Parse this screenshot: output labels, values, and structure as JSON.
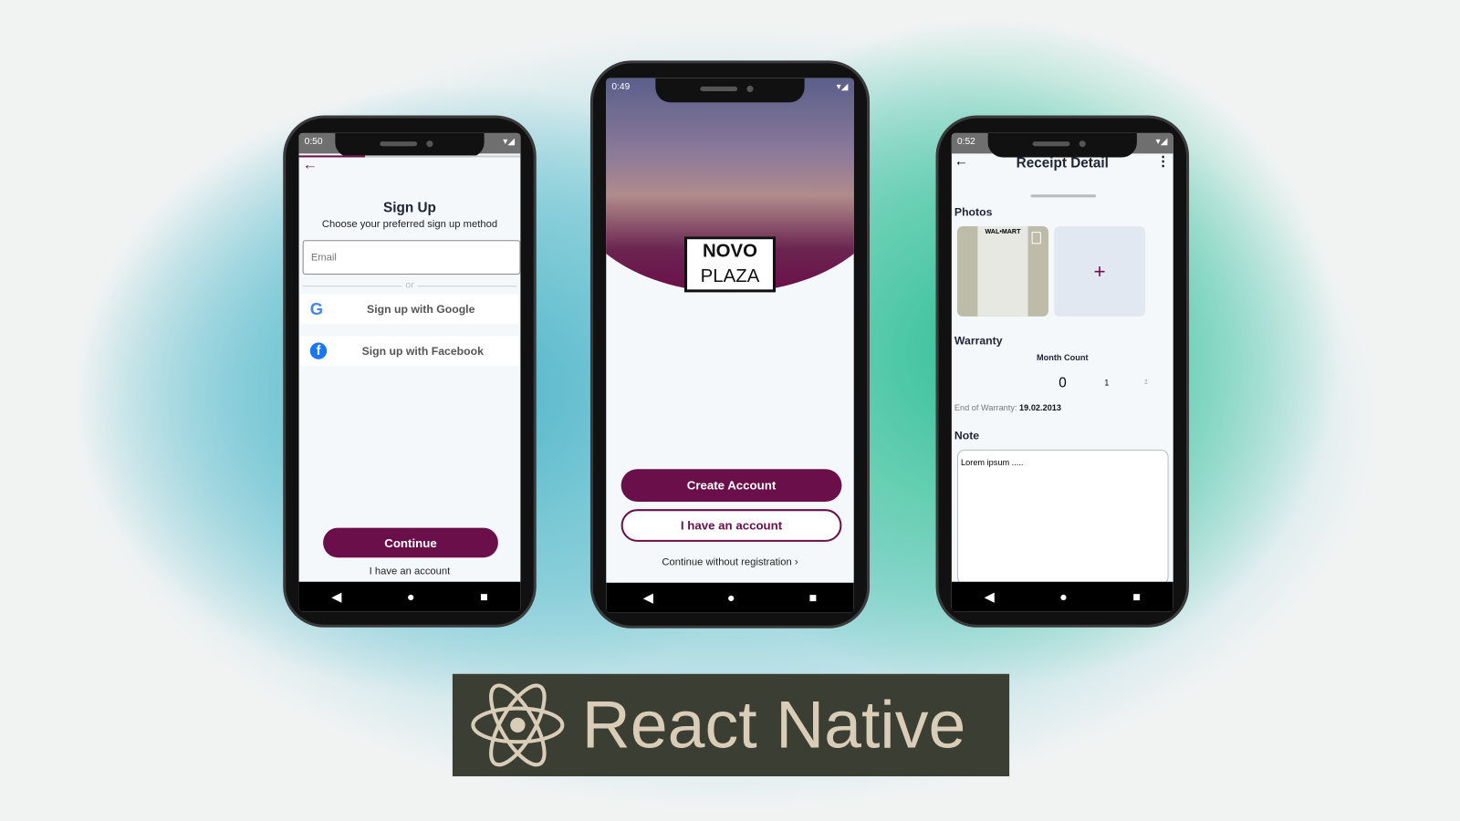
{
  "signup": {
    "time": "0:50",
    "title": "Sign Up",
    "subtitle": "Choose your preferred sign up method",
    "email_placeholder": "Email",
    "or": "or",
    "google": "Sign up with Google",
    "facebook": "Sign up with Facebook",
    "continue": "Continue",
    "have_account": "I have an account"
  },
  "welcome": {
    "time": "0:49",
    "logo_line1": "NOVO",
    "logo_line2": "PLAZA",
    "create": "Create Account",
    "have_account": "I have an account",
    "continue_without": "Continue without registration"
  },
  "receipt": {
    "time": "0:52",
    "title": "Receipt Detail",
    "photos": "Photos",
    "receipt_store": "WAL•MART",
    "add": "+",
    "warranty": "Warranty",
    "month_count": "Month Count",
    "months": [
      "0",
      "1",
      "2"
    ],
    "end_label": "End of Warranty:",
    "end_date": "19.02.2013",
    "note": "Note",
    "note_value": "Lorem ipsum ....."
  },
  "banner": {
    "text": "React Native"
  },
  "colors": {
    "accent": "#6b0f4a"
  }
}
